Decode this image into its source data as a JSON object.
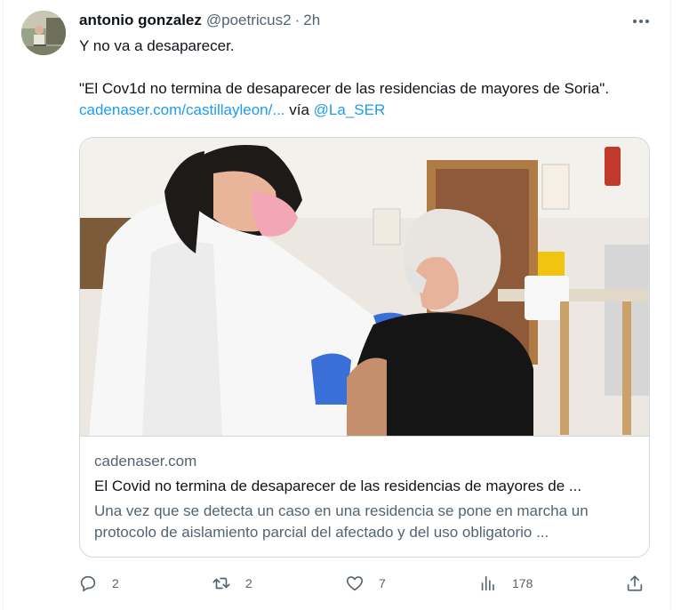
{
  "tweet": {
    "author": {
      "display_name": "antonio gonzalez",
      "handle": "@poetricus2",
      "separator": "·",
      "time": "2h"
    },
    "text_line1": "Y no va a desaparecer.",
    "quote_text": "\"El Cov1d no termina de desaparecer de las residencias de mayores de Soria\".",
    "link_text": "cadenaser.com/castillayleon/...",
    "via_text": "vía",
    "mention": "@La_SER"
  },
  "card": {
    "domain": "cadenaser.com",
    "title": "El Covid no termina de desaparecer de las residencias de mayores de ...",
    "description": "Una vez que se detecta un caso en una residencia se pone en marcha un protocolo de aislamiento parcial del afectado y del uso obligatorio ...",
    "image_icon": "photo-vaccination-icon"
  },
  "actions": {
    "reply_count": "2",
    "retweet_count": "2",
    "like_count": "7",
    "views_count": "178"
  },
  "icons": {
    "more": "more-dots-icon",
    "reply": "reply-icon",
    "retweet": "retweet-icon",
    "like": "heart-icon",
    "views": "views-icon",
    "share": "share-icon"
  },
  "colors": {
    "link": "#1d9bf0",
    "secondary_text": "#536471",
    "border": "#cfd9de"
  }
}
